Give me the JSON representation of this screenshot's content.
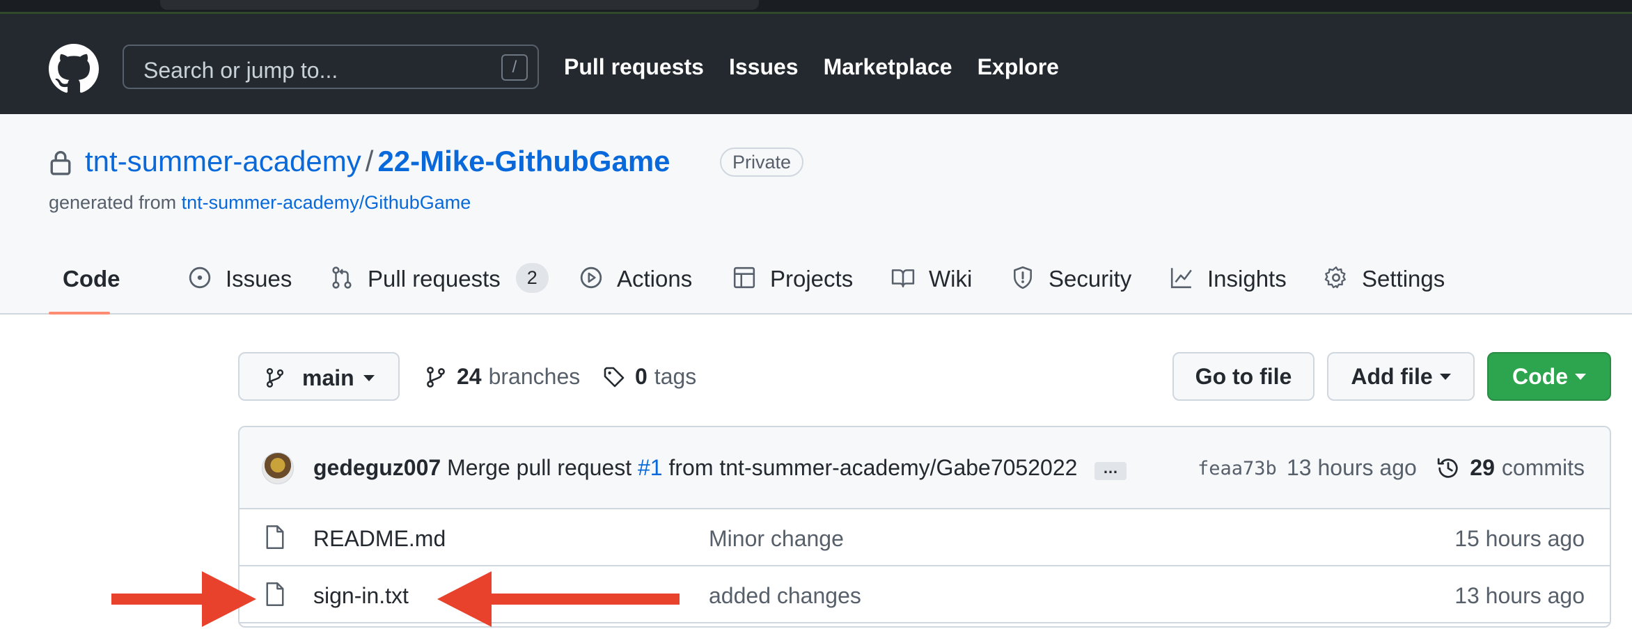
{
  "header": {
    "search_placeholder": "Search or jump to...",
    "search_shortcut": "/",
    "nav": [
      "Pull requests",
      "Issues",
      "Marketplace",
      "Explore"
    ]
  },
  "repo": {
    "owner": "tnt-summer-academy",
    "separator": "/",
    "name": "22-Mike-GithubGame",
    "visibility": "Private",
    "generated_prefix": "generated from",
    "template": "tnt-summer-academy/GithubGame"
  },
  "tabs": [
    {
      "label": "Code",
      "icon": "code-icon"
    },
    {
      "label": "Issues",
      "icon": "issue-opened-icon"
    },
    {
      "label": "Pull requests",
      "icon": "git-pull-request-icon",
      "count": "2"
    },
    {
      "label": "Actions",
      "icon": "play-icon"
    },
    {
      "label": "Projects",
      "icon": "table-icon"
    },
    {
      "label": "Wiki",
      "icon": "book-icon"
    },
    {
      "label": "Security",
      "icon": "shield-icon"
    },
    {
      "label": "Insights",
      "icon": "graph-icon"
    },
    {
      "label": "Settings",
      "icon": "gear-icon"
    }
  ],
  "toolbar": {
    "branch": "main",
    "branches_count": "24",
    "branches_label": "branches",
    "tags_count": "0",
    "tags_label": "tags",
    "go_to_file": "Go to file",
    "add_file": "Add file",
    "code": "Code"
  },
  "commit": {
    "author": "gedeguz007",
    "message_prefix": "Merge pull request",
    "pr_ref": "#1",
    "message_suffix": "from tnt-summer-academy/Gabe7052022",
    "ellipsis": "…",
    "sha": "feaa73b",
    "time": "13 hours ago",
    "commits_count": "29",
    "commits_label": "commits"
  },
  "files": [
    {
      "name": "README.md",
      "message": "Minor change",
      "time": "15 hours ago"
    },
    {
      "name": "sign-in.txt",
      "message": "added changes",
      "time": "13 hours ago"
    }
  ],
  "colors": {
    "header_bg": "#24292f",
    "link": "#0969da",
    "active_tab_underline": "#fd8c73",
    "primary_button": "#2da44e",
    "annotation_arrow": "#e8412c"
  }
}
